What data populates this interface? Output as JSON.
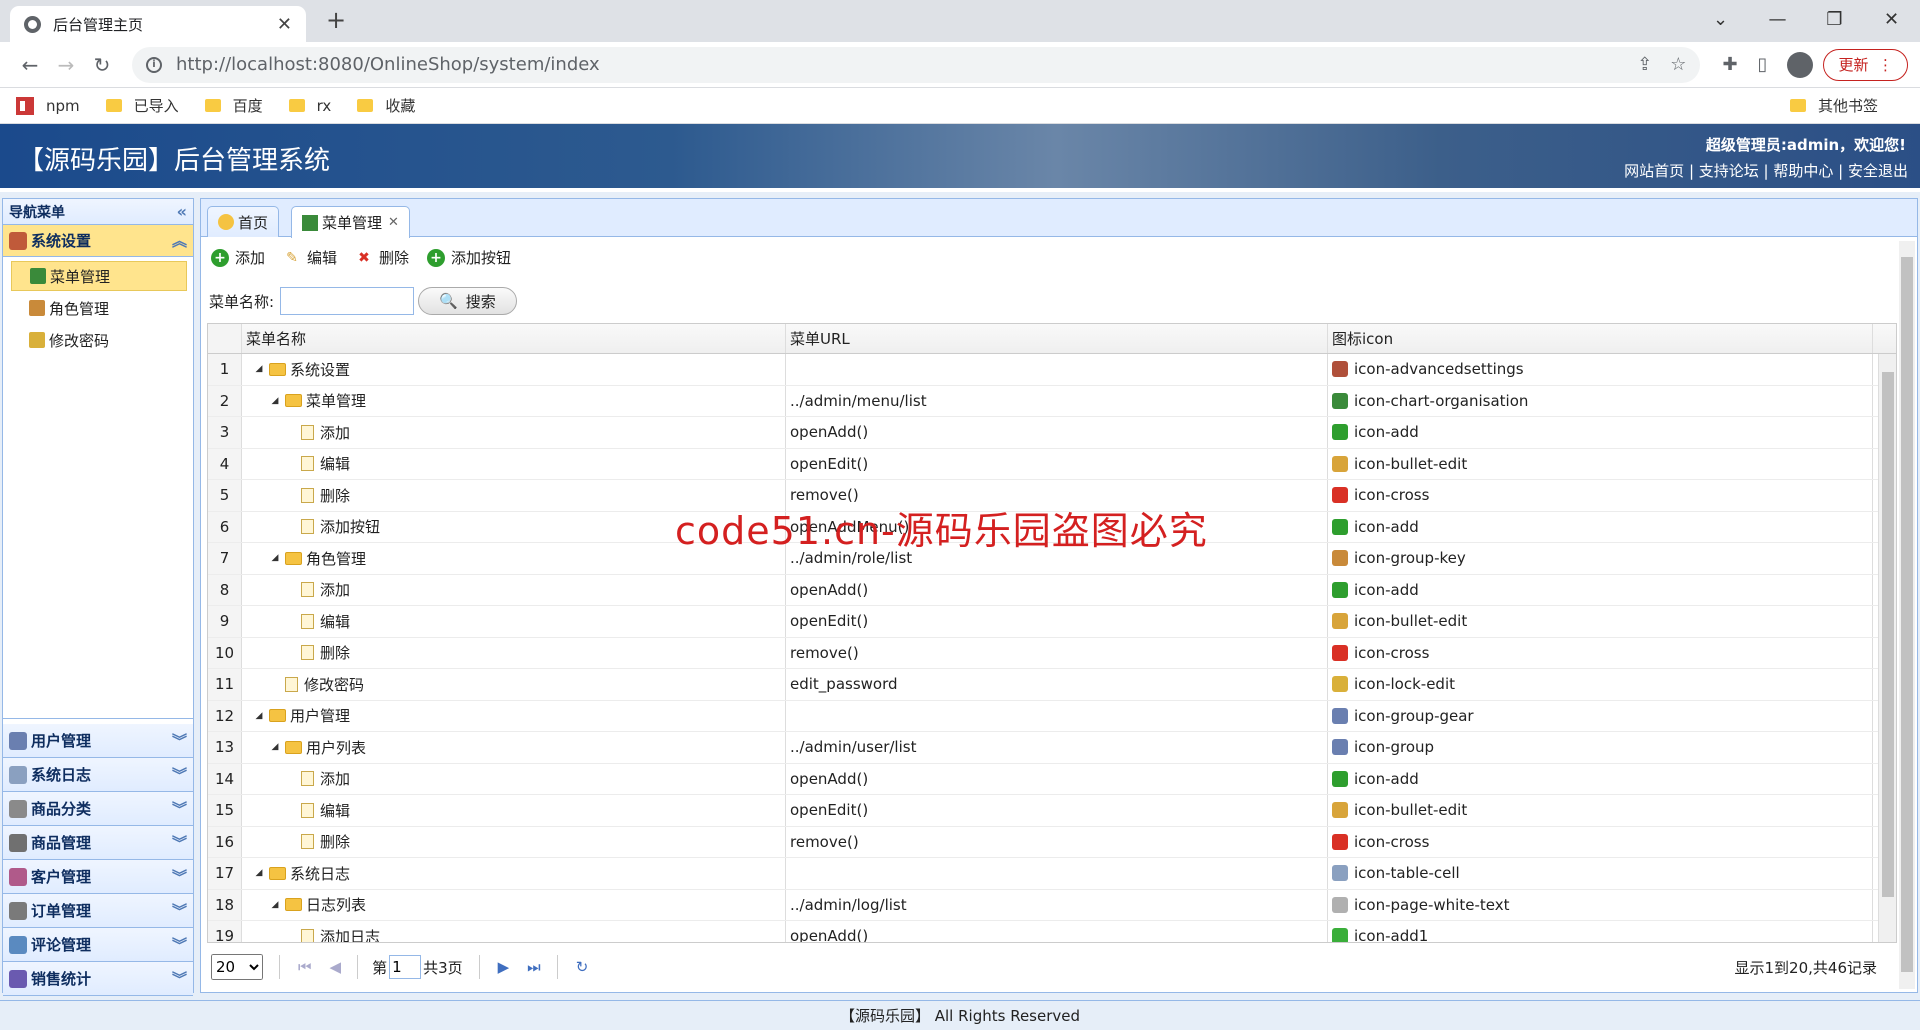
{
  "browser": {
    "tab_title": "后台管理主页",
    "url": "http://localhost:8080/OnlineShop/system/index",
    "update_label": "更新",
    "bookmarks": [
      "npm",
      "已导入",
      "百度",
      "rx",
      "收藏"
    ],
    "other_bookmarks": "其他书签"
  },
  "header": {
    "title": "【源码乐园】后台管理系统",
    "user_greeting": "超级管理员:admin，欢迎您!",
    "links": [
      "网站首页",
      "支持论坛",
      "帮助中心",
      "安全退出"
    ]
  },
  "sidebar": {
    "title": "导航菜单",
    "active_section": "系统设置",
    "active_items": [
      "菜单管理",
      "角色管理",
      "修改密码"
    ],
    "sections": [
      "用户管理",
      "系统日志",
      "商品分类",
      "商品管理",
      "客户管理",
      "订单管理",
      "评论管理",
      "销售统计"
    ]
  },
  "tabs": [
    {
      "label": "首页"
    },
    {
      "label": "菜单管理",
      "closable": true
    }
  ],
  "toolbar": {
    "add": "添加",
    "edit": "编辑",
    "delete": "删除",
    "add_button": "添加按钮"
  },
  "search": {
    "label": "菜单名称:",
    "value": "",
    "button": "搜索"
  },
  "grid": {
    "columns": [
      "菜单名称",
      "菜单URL",
      "图标icon"
    ],
    "rows": [
      {
        "no": "1",
        "level": 0,
        "type": "folder",
        "name": "系统设置",
        "url": "",
        "icon": "icon-advancedsettings",
        "icolor": "#b0503a"
      },
      {
        "no": "2",
        "level": 1,
        "type": "folder",
        "name": "菜单管理",
        "url": "../admin/menu/list",
        "icon": "icon-chart-organisation",
        "icolor": "#3a8a3a"
      },
      {
        "no": "3",
        "level": 2,
        "type": "leaf",
        "name": "添加",
        "url": "openAdd()",
        "icon": "icon-add",
        "icolor": "#2e9e2e"
      },
      {
        "no": "4",
        "level": 2,
        "type": "leaf",
        "name": "编辑",
        "url": "openEdit()",
        "icon": "icon-bullet-edit",
        "icolor": "#d8a43a"
      },
      {
        "no": "5",
        "level": 2,
        "type": "leaf",
        "name": "删除",
        "url": "remove()",
        "icon": "icon-cross",
        "icolor": "#d93025"
      },
      {
        "no": "6",
        "level": 2,
        "type": "leaf",
        "name": "添加按钮",
        "url": "openAddMenu()",
        "icon": "icon-add",
        "icolor": "#2e9e2e"
      },
      {
        "no": "7",
        "level": 1,
        "type": "folder",
        "name": "角色管理",
        "url": "../admin/role/list",
        "icon": "icon-group-key",
        "icolor": "#c98a3a"
      },
      {
        "no": "8",
        "level": 2,
        "type": "leaf",
        "name": "添加",
        "url": "openAdd()",
        "icon": "icon-add",
        "icolor": "#2e9e2e"
      },
      {
        "no": "9",
        "level": 2,
        "type": "leaf",
        "name": "编辑",
        "url": "openEdit()",
        "icon": "icon-bullet-edit",
        "icolor": "#d8a43a"
      },
      {
        "no": "10",
        "level": 2,
        "type": "leaf",
        "name": "删除",
        "url": "remove()",
        "icon": "icon-cross",
        "icolor": "#d93025"
      },
      {
        "no": "11",
        "level": 1,
        "type": "leaf",
        "name": "修改密码",
        "url": "edit_password",
        "icon": "icon-lock-edit",
        "icolor": "#d9b03a"
      },
      {
        "no": "12",
        "level": 0,
        "type": "folder",
        "name": "用户管理",
        "url": "",
        "icon": "icon-group-gear",
        "icolor": "#6a7fb0"
      },
      {
        "no": "13",
        "level": 1,
        "type": "folder",
        "name": "用户列表",
        "url": "../admin/user/list",
        "icon": "icon-group",
        "icolor": "#6a7fb0"
      },
      {
        "no": "14",
        "level": 2,
        "type": "leaf",
        "name": "添加",
        "url": "openAdd()",
        "icon": "icon-add",
        "icolor": "#2e9e2e"
      },
      {
        "no": "15",
        "level": 2,
        "type": "leaf",
        "name": "编辑",
        "url": "openEdit()",
        "icon": "icon-bullet-edit",
        "icolor": "#d8a43a"
      },
      {
        "no": "16",
        "level": 2,
        "type": "leaf",
        "name": "删除",
        "url": "remove()",
        "icon": "icon-cross",
        "icolor": "#d93025"
      },
      {
        "no": "17",
        "level": 0,
        "type": "folder",
        "name": "系统日志",
        "url": "",
        "icon": "icon-table-cell",
        "icolor": "#8aa0c0"
      },
      {
        "no": "18",
        "level": 1,
        "type": "folder",
        "name": "日志列表",
        "url": "../admin/log/list",
        "icon": "icon-page-white-text",
        "icolor": "#b0b0b0"
      },
      {
        "no": "19",
        "level": 2,
        "type": "leaf",
        "name": "添加日志",
        "url": "openAdd()",
        "icon": "icon-add1",
        "icolor": "#3aae3a"
      }
    ]
  },
  "pager": {
    "page_size": "20",
    "page_label_before": "第",
    "current_page": "1",
    "page_label_after": "共3页",
    "info": "显示1到20,共46记录"
  },
  "watermark": "code51.cn-源码乐园盗图必究",
  "footer": "【源码乐园】 All Rights Reserved"
}
